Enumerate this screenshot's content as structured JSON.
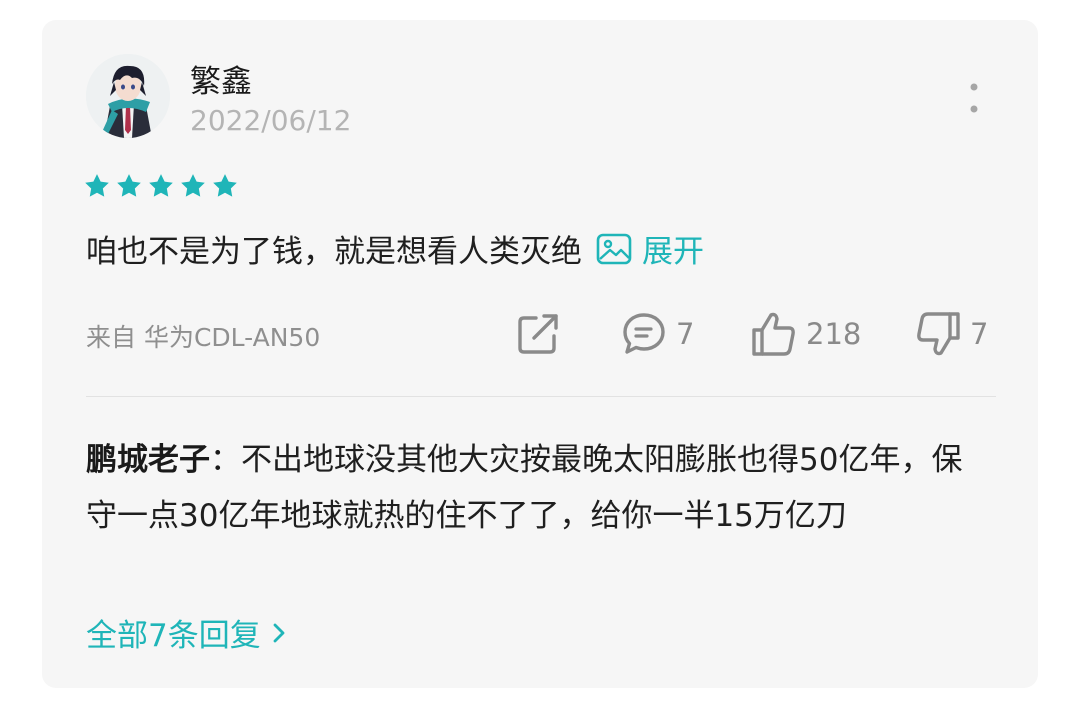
{
  "comment": {
    "username": "繁鑫",
    "date": "2022/06/12",
    "rating": 5,
    "text": "咱也不是为了钱，就是想看人类灭绝",
    "expand_label": "展开",
    "device": "来自 华为CDL-AN50",
    "actions": {
      "reply_count": "7",
      "like_count": "218",
      "dislike_count": "7"
    }
  },
  "reply": {
    "author": "鹏城老子",
    "separator": "：",
    "text": "不出地球没其他大灾按最晚太阳膨胀也得50亿年，保守一点30亿年地球就热的住不了了，给你一半15万亿刀"
  },
  "all_replies_label": "全部7条回复",
  "colors": {
    "accent": "#1fb5b8",
    "card_bg": "#f6f6f6",
    "muted": "#8a8a8a"
  },
  "icons": [
    "avatar",
    "more-vertical-icon",
    "star-icon",
    "image-icon",
    "share-icon",
    "comment-icon",
    "thumbs-up-icon",
    "thumbs-down-icon",
    "chevron-right-icon"
  ]
}
